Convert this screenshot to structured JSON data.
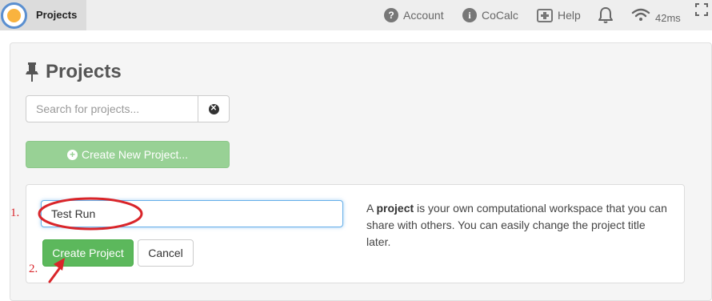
{
  "header": {
    "projects_tab": "Projects",
    "account_label": "Account",
    "cocalc_label": "CoCalc",
    "help_label": "Help",
    "ping": "42ms"
  },
  "page": {
    "title": "Projects",
    "search": {
      "placeholder": "Search for projects...",
      "value": ""
    },
    "create_new_button": "Create New Project..."
  },
  "create_form": {
    "title_value": "Test Run",
    "create_button": "Create Project",
    "cancel_button": "Cancel",
    "description": {
      "prefix": "A ",
      "bold": "project",
      "suffix": " is your own computational workspace that you can share with others. You can easily change the project title later."
    }
  },
  "annotations": {
    "step1": "1.",
    "step2": "2."
  },
  "colors": {
    "accent_green": "#5cb85c",
    "disabled_green": "#98d195",
    "annotation_red": "#d9252a",
    "focus_blue": "#66afe9"
  },
  "icons": [
    "cocalc-logo-icon",
    "question-circle-icon",
    "info-circle-icon",
    "medkit-icon",
    "bell-icon",
    "wifi-icon",
    "fullscreen-icon",
    "thumbtack-icon",
    "times-circle-icon",
    "plus-circle-icon"
  ]
}
